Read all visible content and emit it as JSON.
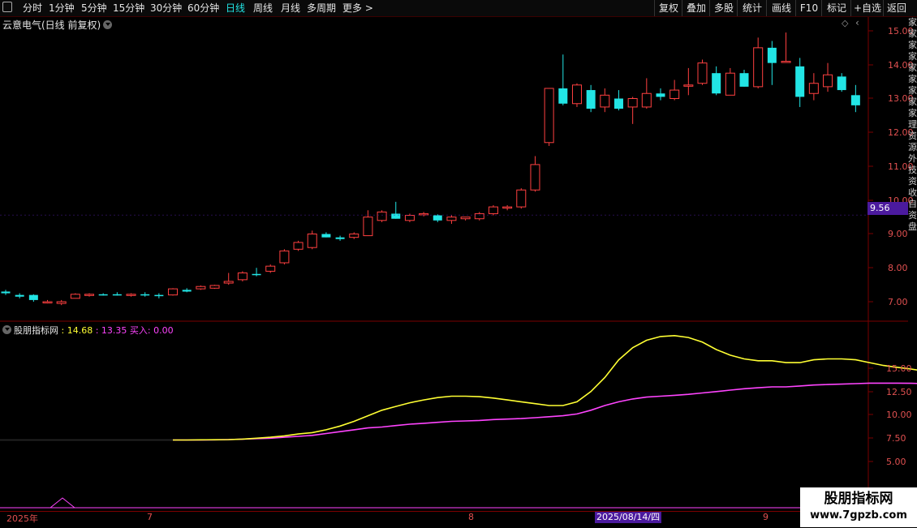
{
  "toolbar": {
    "menu_icon": "menu-icon",
    "periods": [
      "分时",
      "1分钟",
      "5分钟",
      "15分钟",
      "30分钟",
      "60分钟",
      "日线",
      "周线",
      "月线",
      "多周期",
      "更多 >"
    ],
    "active_period": "日线",
    "right_buttons": [
      "复权",
      "叠加",
      "多股",
      "统计",
      "画线",
      "F10",
      "标记",
      "+自选",
      "返回"
    ]
  },
  "stock": {
    "title": "云意电气(日线 前复权)"
  },
  "price_axis": [
    "15.00",
    "14.00",
    "13.00",
    "12.00",
    "11.00",
    "10.00",
    "9.00",
    "8.00",
    "7.00"
  ],
  "current_price": "9.56",
  "indicator": {
    "name": "股朋指标网",
    "v1": ": 14.68",
    "v2": ": 13.35",
    "v3": "买入: 0.00",
    "colors": {
      "v1": "#ffff33",
      "v2": "#ff44ff",
      "v3": "#ff44ff"
    }
  },
  "indicator_axis": [
    "15.00",
    "12.50",
    "10.00",
    "7.50",
    "5.00"
  ],
  "x_axis": {
    "labels": [
      "2025年",
      "7",
      "8",
      "9"
    ],
    "cursor_date": "2025/08/14/四"
  },
  "right_strip_text": "家家家家家家家家家理资源外技资收自资盘",
  "watermark": {
    "line1": "股朋指标网",
    "line2": "www.7gpzb.com"
  },
  "colors": {
    "up": "#ff4040",
    "down": "#22e5e5",
    "ma_yellow": "#ffff33",
    "ma_magenta": "#ff44ff",
    "grid": "#7a0000"
  },
  "chart_data": {
    "type": "candlestick",
    "ylim": [
      6.5,
      15.3
    ],
    "candles": [
      [
        7.3,
        7.35,
        7.2,
        7.25
      ],
      [
        7.2,
        7.25,
        7.1,
        7.15
      ],
      [
        7.2,
        7.22,
        7.0,
        7.05
      ],
      [
        7.0,
        7.05,
        6.95,
        7.0
      ],
      [
        6.95,
        7.05,
        6.9,
        7.0
      ],
      [
        7.1,
        7.25,
        7.1,
        7.22
      ],
      [
        7.2,
        7.25,
        7.15,
        7.22
      ],
      [
        7.22,
        7.25,
        7.18,
        7.2
      ],
      [
        7.22,
        7.28,
        7.18,
        7.2
      ],
      [
        7.2,
        7.25,
        7.15,
        7.22
      ],
      [
        7.22,
        7.28,
        7.15,
        7.2
      ],
      [
        7.2,
        7.25,
        7.1,
        7.18
      ],
      [
        7.2,
        7.4,
        7.18,
        7.38
      ],
      [
        7.35,
        7.4,
        7.28,
        7.3
      ],
      [
        7.38,
        7.48,
        7.35,
        7.45
      ],
      [
        7.4,
        7.5,
        7.38,
        7.48
      ],
      [
        7.55,
        7.85,
        7.5,
        7.6
      ],
      [
        7.65,
        7.9,
        7.6,
        7.85
      ],
      [
        7.82,
        8.0,
        7.75,
        7.8
      ],
      [
        7.9,
        8.1,
        7.85,
        8.05
      ],
      [
        8.15,
        8.55,
        8.1,
        8.5
      ],
      [
        8.55,
        8.8,
        8.5,
        8.75
      ],
      [
        8.6,
        9.1,
        8.55,
        9.0
      ],
      [
        9.0,
        9.05,
        8.9,
        8.9
      ],
      [
        8.9,
        8.95,
        8.8,
        8.85
      ],
      [
        8.9,
        9.05,
        8.85,
        9.0
      ],
      [
        8.95,
        9.7,
        8.95,
        9.5
      ],
      [
        9.4,
        9.7,
        9.35,
        9.65
      ],
      [
        9.6,
        9.95,
        9.45,
        9.45
      ],
      [
        9.4,
        9.6,
        9.35,
        9.55
      ],
      [
        9.6,
        9.65,
        9.52,
        9.6
      ],
      [
        9.55,
        9.58,
        9.35,
        9.4
      ],
      [
        9.4,
        9.55,
        9.3,
        9.5
      ],
      [
        9.45,
        9.5,
        9.4,
        9.5
      ],
      [
        9.45,
        9.65,
        9.4,
        9.6
      ],
      [
        9.6,
        9.85,
        9.55,
        9.8
      ],
      [
        9.8,
        9.85,
        9.7,
        9.8
      ],
      [
        9.8,
        10.35,
        9.75,
        10.3
      ],
      [
        10.3,
        11.3,
        10.25,
        11.05
      ],
      [
        11.7,
        13.3,
        11.6,
        13.3
      ],
      [
        13.3,
        14.3,
        12.8,
        12.85
      ],
      [
        12.85,
        13.45,
        12.75,
        13.4
      ],
      [
        13.25,
        13.4,
        12.6,
        12.7
      ],
      [
        12.75,
        13.3,
        12.6,
        13.1
      ],
      [
        13.0,
        13.25,
        12.65,
        12.7
      ],
      [
        12.75,
        13.05,
        12.25,
        13.0
      ],
      [
        12.75,
        13.6,
        12.7,
        13.15
      ],
      [
        13.15,
        13.3,
        12.95,
        13.05
      ],
      [
        13.0,
        13.55,
        12.95,
        13.25
      ],
      [
        13.4,
        13.9,
        13.1,
        13.4
      ],
      [
        13.45,
        14.15,
        13.4,
        14.05
      ],
      [
        13.75,
        13.95,
        13.1,
        13.15
      ],
      [
        13.1,
        13.9,
        13.1,
        13.75
      ],
      [
        13.75,
        13.85,
        13.35,
        13.35
      ],
      [
        13.35,
        14.8,
        13.3,
        14.5
      ],
      [
        14.5,
        14.7,
        13.4,
        14.05
      ],
      [
        14.1,
        14.95,
        14.1,
        14.1
      ],
      [
        13.95,
        14.2,
        12.75,
        13.05
      ],
      [
        13.15,
        13.75,
        12.95,
        13.45
      ],
      [
        13.35,
        14.05,
        13.2,
        13.7
      ],
      [
        13.65,
        13.75,
        13.2,
        13.25
      ],
      [
        13.1,
        13.4,
        12.6,
        12.8
      ]
    ],
    "indicator_ylim": [
      2.0,
      19.5
    ],
    "ma1": [
      7.3,
      7.3,
      7.32,
      7.33,
      7.35,
      7.4,
      7.5,
      7.6,
      7.75,
      7.95,
      8.1,
      8.4,
      8.8,
      9.3,
      9.9,
      10.5,
      10.9,
      11.3,
      11.6,
      11.85,
      12.0,
      12.0,
      11.95,
      11.8,
      11.6,
      11.4,
      11.2,
      11.0,
      11.0,
      11.4,
      12.5,
      14.0,
      15.9,
      17.2,
      18.0,
      18.4,
      18.5,
      18.3,
      17.8,
      17.0,
      16.4,
      16.0,
      15.8,
      15.8,
      15.6,
      15.6,
      15.9,
      16.0,
      16.0,
      15.9,
      15.6,
      15.3,
      15.1,
      14.9,
      14.68
    ],
    "ma2": [
      7.3,
      7.3,
      7.3,
      7.32,
      7.35,
      7.4,
      7.45,
      7.5,
      7.6,
      7.7,
      7.8,
      8.0,
      8.2,
      8.4,
      8.6,
      8.7,
      8.85,
      9.0,
      9.1,
      9.2,
      9.3,
      9.35,
      9.4,
      9.5,
      9.55,
      9.6,
      9.7,
      9.8,
      9.9,
      10.1,
      10.5,
      11.0,
      11.4,
      11.7,
      11.9,
      12.0,
      12.1,
      12.2,
      12.35,
      12.5,
      12.65,
      12.8,
      12.9,
      13.0,
      13.0,
      13.1,
      13.2,
      13.25,
      13.3,
      13.35,
      13.4,
      13.4,
      13.4,
      13.38,
      13.35
    ]
  }
}
